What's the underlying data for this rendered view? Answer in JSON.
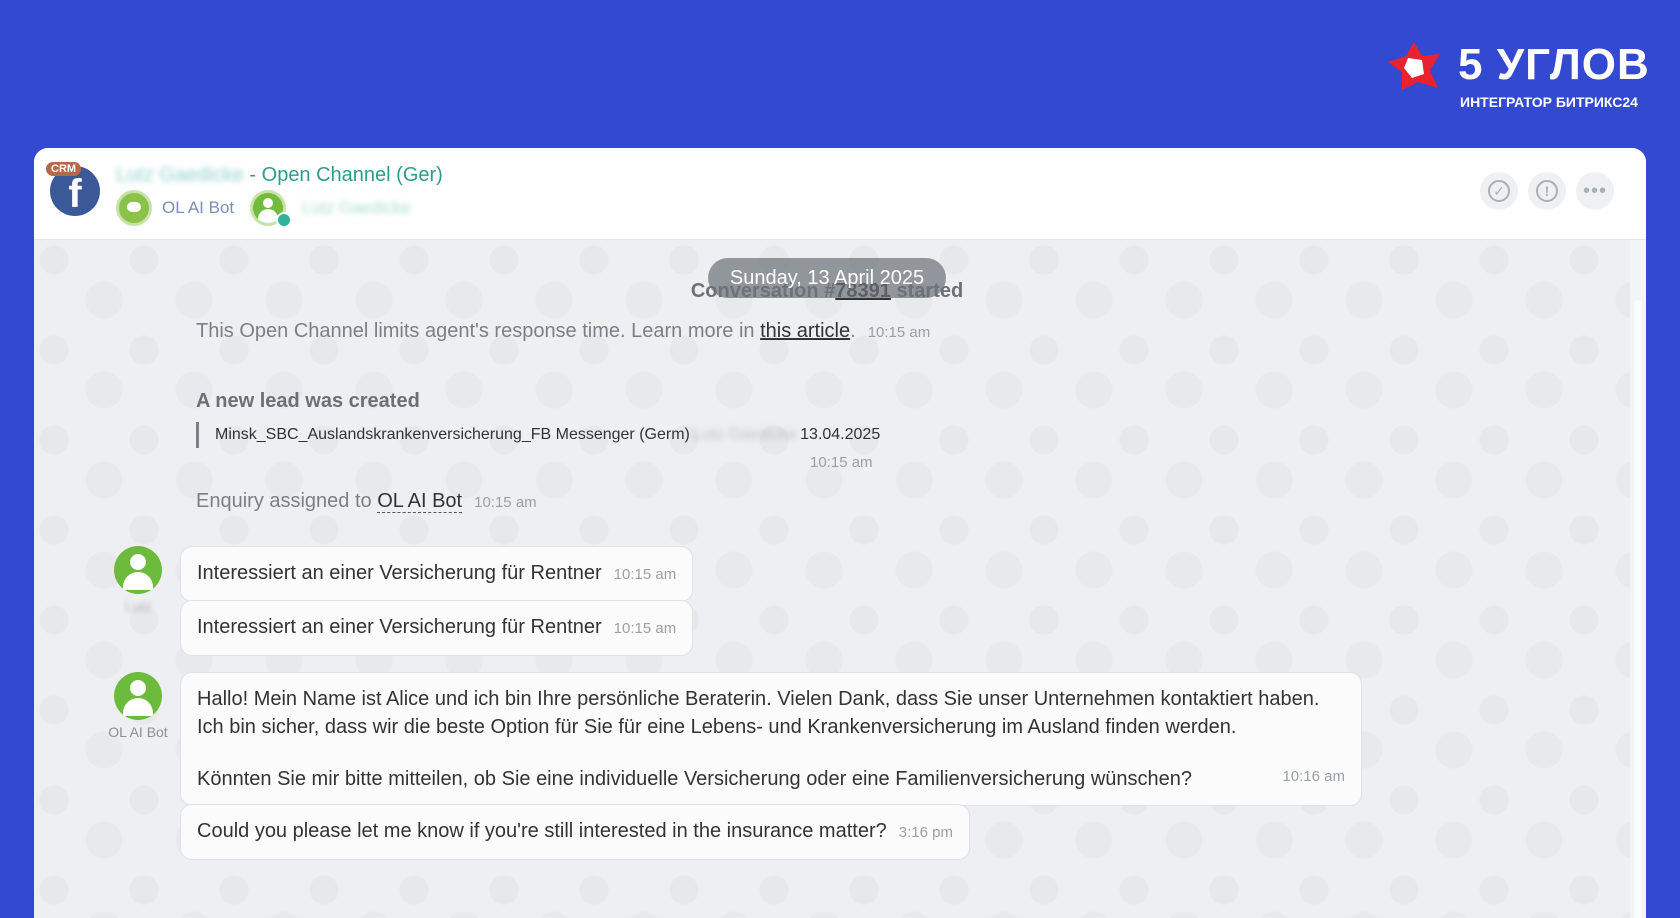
{
  "brand": {
    "name": "5 УГЛОВ",
    "tagline": "ИНТЕГРАТОР БИТРИКС24",
    "logo_color": "#e8222e"
  },
  "header": {
    "crm_badge": "CRM",
    "contact_name": "Lutz Gaedicke",
    "title_suffix": " - Open Channel (Ger)",
    "bot_name": "OL AI Bot",
    "user_name": "Lutz Gaedicke",
    "actions": [
      "check-icon",
      "alert-icon",
      "more-icon"
    ]
  },
  "feed": {
    "date": "Sunday, 13 April 2025",
    "conversation_prefix": "Conversation #",
    "conversation_id": "78391",
    "conversation_suffix": " started",
    "response_limit_text": "This Open Channel limits agent's response time. Learn more in ",
    "response_limit_link": "this article",
    "response_limit_end": ".",
    "response_limit_time": "10:15 am",
    "lead_title": "A new lead was created",
    "lead_name": "Minsk_SBC_Auslandskrankenversicherung_FB Messenger (Germ)",
    "lead_contact": "Lutz Gaedicke",
    "lead_date": "13.04.2025",
    "lead_time": "10:15 am",
    "assigned_text": "Enquiry assigned to ",
    "assigned_agent": "OL AI Bot",
    "assigned_time": "10:15 am"
  },
  "messages": [
    {
      "author": "Lutz",
      "text": "Interessiert an einer Versicherung für Rentner",
      "time": "10:15 am"
    },
    {
      "author": "Lutz",
      "text": "Interessiert an einer Versicherung für Rentner",
      "time": "10:15 am"
    },
    {
      "author": "OL AI Bot",
      "line1": "Hallo! Mein Name ist Alice und ich bin Ihre persönliche Beraterin. Vielen Dank, dass Sie unser Unternehmen kontaktiert haben.",
      "line2": "Ich bin sicher, dass wir die beste Option für Sie für eine Lebens- und Krankenversicherung im Ausland finden werden.",
      "line3": "Könnten Sie mir bitte mitteilen, ob Sie eine individuelle Versicherung oder eine Familienversicherung wünschen?",
      "time": "10:16 am"
    },
    {
      "author": "OL AI Bot",
      "text": "Could you please let me know if you're still interested in the insurance matter?",
      "time": "3:16 pm"
    }
  ]
}
